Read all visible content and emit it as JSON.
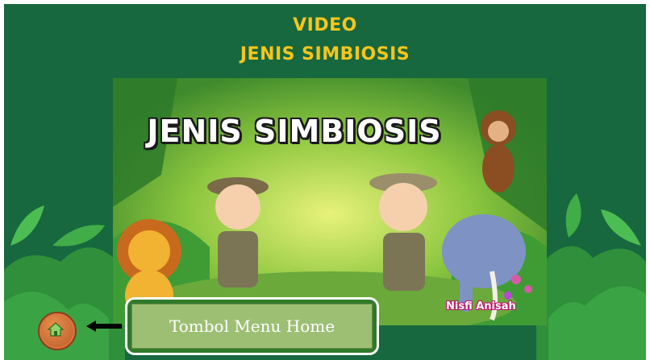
{
  "header": {
    "line1": "VIDEO",
    "line2": "JENIS SIMBIOSIS"
  },
  "video": {
    "title": "JENIS SIMBIOSIS",
    "watermark": "Nisfi Anisah"
  },
  "home_button": {
    "icon": "home-icon"
  },
  "annotation": {
    "label": "Tombol Menu Home"
  },
  "colors": {
    "background": "#17683e",
    "title": "#f7c51c",
    "callout": "#9dbf74",
    "home_button": "#d9783c"
  }
}
